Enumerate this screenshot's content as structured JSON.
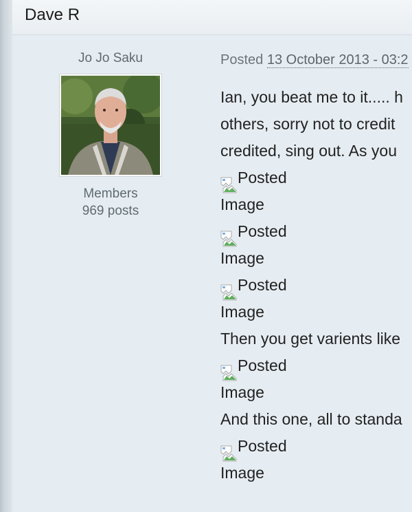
{
  "header": {
    "title": "Dave R"
  },
  "author": {
    "name": "Jo Jo Saku",
    "group": "Members",
    "posts": "969 posts"
  },
  "post": {
    "meta_prefix": "Posted ",
    "date": "13 October 2013 - 03:2",
    "lines": [
      "Ian, you beat me to it..... h",
      "others, sorry not to credit",
      "credited, sing out. As you"
    ],
    "image_alt": "Posted",
    "image_label": "Image",
    "middle_text": "Then you get varients like",
    "last_text": "And this one, all to standa"
  },
  "icons": {
    "broken_image": "broken-image-icon",
    "avatar": "avatar"
  },
  "colors": {
    "background": "#e6edf2",
    "header": "#eef2f5",
    "text": "#222222",
    "muted": "#5e6a72"
  }
}
